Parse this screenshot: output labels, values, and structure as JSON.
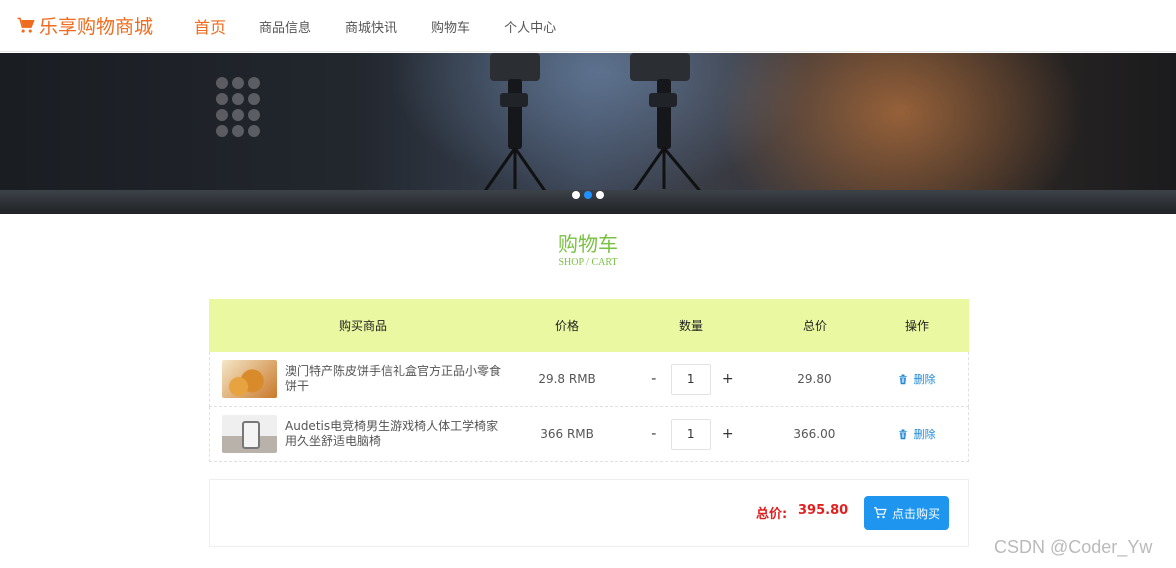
{
  "header": {
    "logo_text": "乐享购物商城",
    "logo_icon": "cart-icon",
    "nav": [
      "首页",
      "商品信息",
      "商城快讯",
      "购物车",
      "个人中心"
    ],
    "active_index": 0
  },
  "banner": {
    "slides_count": 3,
    "active_slide": 1
  },
  "section": {
    "title": "购物车",
    "subtitle": "SHOP / CART"
  },
  "cart": {
    "headers": [
      "购买商品",
      "价格",
      "数量",
      "总价",
      "操作"
    ],
    "items": [
      {
        "name": "澳门特产陈皮饼手信礼盒官方正品小零食饼干",
        "price": "29.8 RMB",
        "qty": "1",
        "total": "29.80",
        "delete_label": "删除"
      },
      {
        "name": "Audetis电竞椅男生游戏椅人体工学椅家用久坐舒适电脑椅",
        "price": "366 RMB",
        "qty": "1",
        "total": "366.00",
        "delete_label": "删除"
      }
    ],
    "minus_label": "-",
    "plus_label": "+"
  },
  "summary": {
    "total_label": "总价:",
    "total_value": "395.80",
    "buy_label": "点击购买"
  },
  "watermark": "CSDN @Coder_Yw",
  "colors": {
    "brand": "#ef6b1d",
    "accent_green": "#7ac143",
    "table_head": "#eaf9a1",
    "link_blue": "#1e88d6",
    "buy_button": "#1e96f0",
    "price_red": "#e02020"
  }
}
